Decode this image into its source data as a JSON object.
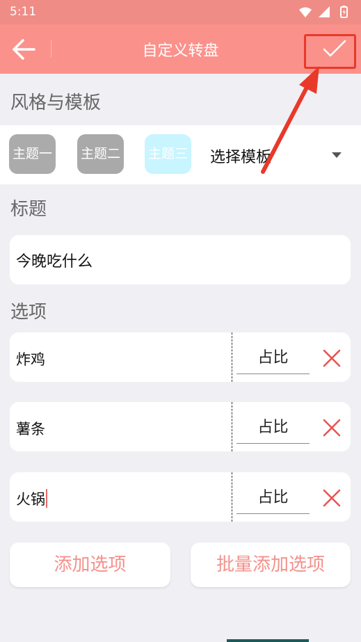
{
  "status_bar": {
    "time": "5:11"
  },
  "app_bar": {
    "title": "自定义转盘"
  },
  "style_section": {
    "label": "风格与模板",
    "themes": [
      {
        "label": "主题一",
        "color": "#ababab"
      },
      {
        "label": "主题二",
        "color": "#a9a9a9"
      },
      {
        "label": "主题三",
        "color": "#c8f5ff"
      }
    ],
    "template_select": {
      "label": "选择模板"
    }
  },
  "title_section": {
    "label": "标题",
    "value": "今晚吃什么"
  },
  "options_section": {
    "label": "选项",
    "items": [
      {
        "name": "炸鸡",
        "ratio_placeholder": "占比"
      },
      {
        "name": "薯条",
        "ratio_placeholder": "占比"
      },
      {
        "name": "火锅",
        "ratio_placeholder": "占比"
      }
    ]
  },
  "actions": {
    "add_option": "添加选项",
    "batch_add_option": "批量添加选项"
  },
  "colors": {
    "app_bar": "#fb918b",
    "status_bar": "#f08c86",
    "accent_text": "#f4918b",
    "delete_icon": "#e85454",
    "annotation": "#e8392a",
    "selected_theme": "#c8f5ff"
  },
  "icons": {
    "back": "back-arrow-icon",
    "confirm": "check-icon",
    "dropdown": "caret-down-icon",
    "delete": "close-x-icon"
  }
}
